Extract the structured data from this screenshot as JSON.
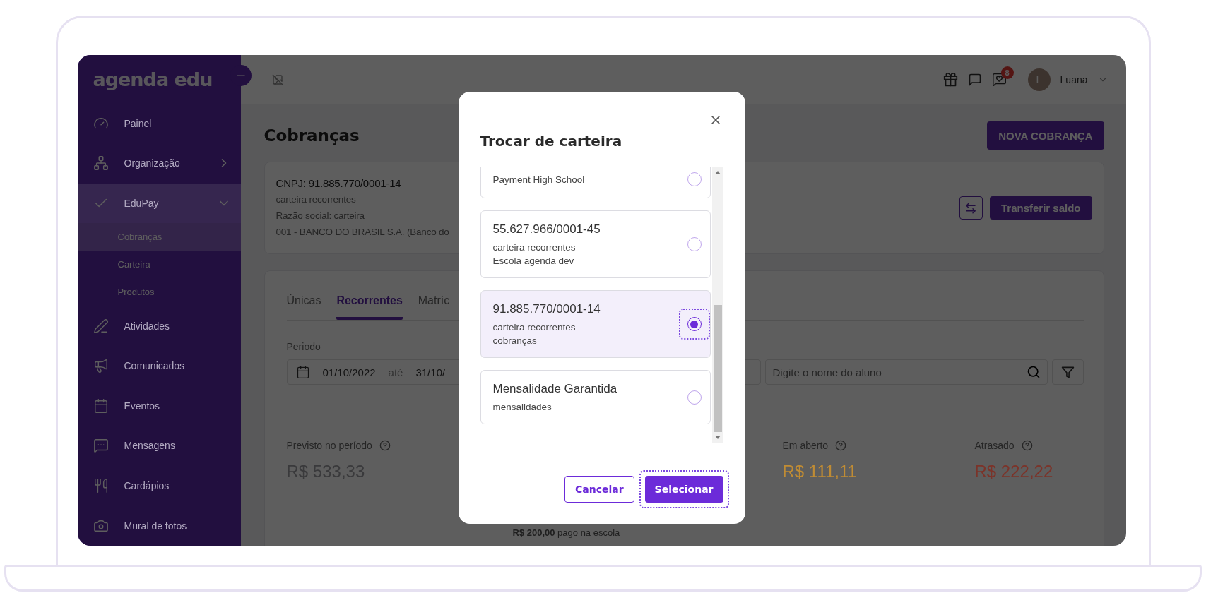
{
  "sidebar": {
    "logo": "agenda edu",
    "items": [
      {
        "label": "Painel",
        "kind": "link",
        "selected": false
      },
      {
        "label": "Organização",
        "kind": "group",
        "expanded": false,
        "selected": false
      },
      {
        "label": "EduPay",
        "kind": "group",
        "expanded": true,
        "selected": true,
        "children": [
          {
            "label": "Cobranças",
            "selected": true
          },
          {
            "label": "Carteira",
            "selected": false
          },
          {
            "label": "Produtos",
            "selected": false
          }
        ]
      },
      {
        "label": "Atividades",
        "kind": "link",
        "selected": false
      },
      {
        "label": "Comunicados",
        "kind": "link",
        "selected": false
      },
      {
        "label": "Eventos",
        "kind": "link",
        "selected": false
      },
      {
        "label": "Mensagens",
        "kind": "link",
        "selected": false
      },
      {
        "label": "Cardápios",
        "kind": "link",
        "selected": false
      },
      {
        "label": "Mural de fotos",
        "kind": "link",
        "selected": false
      }
    ]
  },
  "topbar": {
    "badge": "8",
    "user": {
      "initial": "L",
      "name": "Luana"
    }
  },
  "page": {
    "title": "Cobranças",
    "new_button": "NOVA COBRANÇA",
    "wallet_card": {
      "lines": [
        {
          "kind": "heading",
          "text": "CNPJ: 91.885.770/0001-14"
        },
        {
          "kind": "text",
          "text": "carteira recorrentes"
        },
        {
          "kind": "text",
          "text": "Razão social: carteira"
        },
        {
          "kind": "text",
          "text": "001 - BANCO DO BRASIL S.A. (Banco do"
        }
      ],
      "transfer_button": "Transferir saldo"
    },
    "tabs": [
      {
        "label": "Únicas",
        "selected": false
      },
      {
        "label": "Recorrentes",
        "selected": true
      },
      {
        "label": "Matríc",
        "selected": false
      }
    ],
    "period": {
      "label": "Periodo",
      "start": "01/10/2022",
      "separator": "até",
      "end": "31/10/"
    },
    "search": {
      "placeholder": "Digite o nome do aluno"
    },
    "stats": [
      {
        "kind": "amount",
        "label": "Previsto no período",
        "value": "R$ 533,33",
        "color": "#3a3a3c"
      },
      {
        "kind": "note",
        "text": "**R$ 200,00** pago na escola"
      },
      {
        "kind": "amount",
        "label": "Em aberto",
        "value": "R$ 111,11",
        "color": "#c08c34"
      },
      {
        "kind": "amount",
        "label": "Atrasado",
        "value": "R$ 222,22",
        "color": "#7c3329"
      }
    ]
  },
  "modal": {
    "title": "Trocar de carteira",
    "wallets": [
      {
        "lines": [
          "Payment High School"
        ],
        "selected": false
      },
      {
        "title": "55.627.966/0001-45",
        "lines": [
          "carteira recorrentes",
          "Escola agenda dev"
        ],
        "selected": false
      },
      {
        "title": "91.885.770/0001-14",
        "lines": [
          "carteira recorrentes",
          "cobranças"
        ],
        "selected": true
      },
      {
        "title": "Mensalidade Garantida",
        "lines": [
          "mensalidades"
        ],
        "selected": false
      }
    ],
    "buttons": [
      {
        "label": "Cancelar",
        "kind": "secondary",
        "focused": false
      },
      {
        "label": "Selecionar",
        "kind": "primary",
        "focused": true
      }
    ]
  }
}
